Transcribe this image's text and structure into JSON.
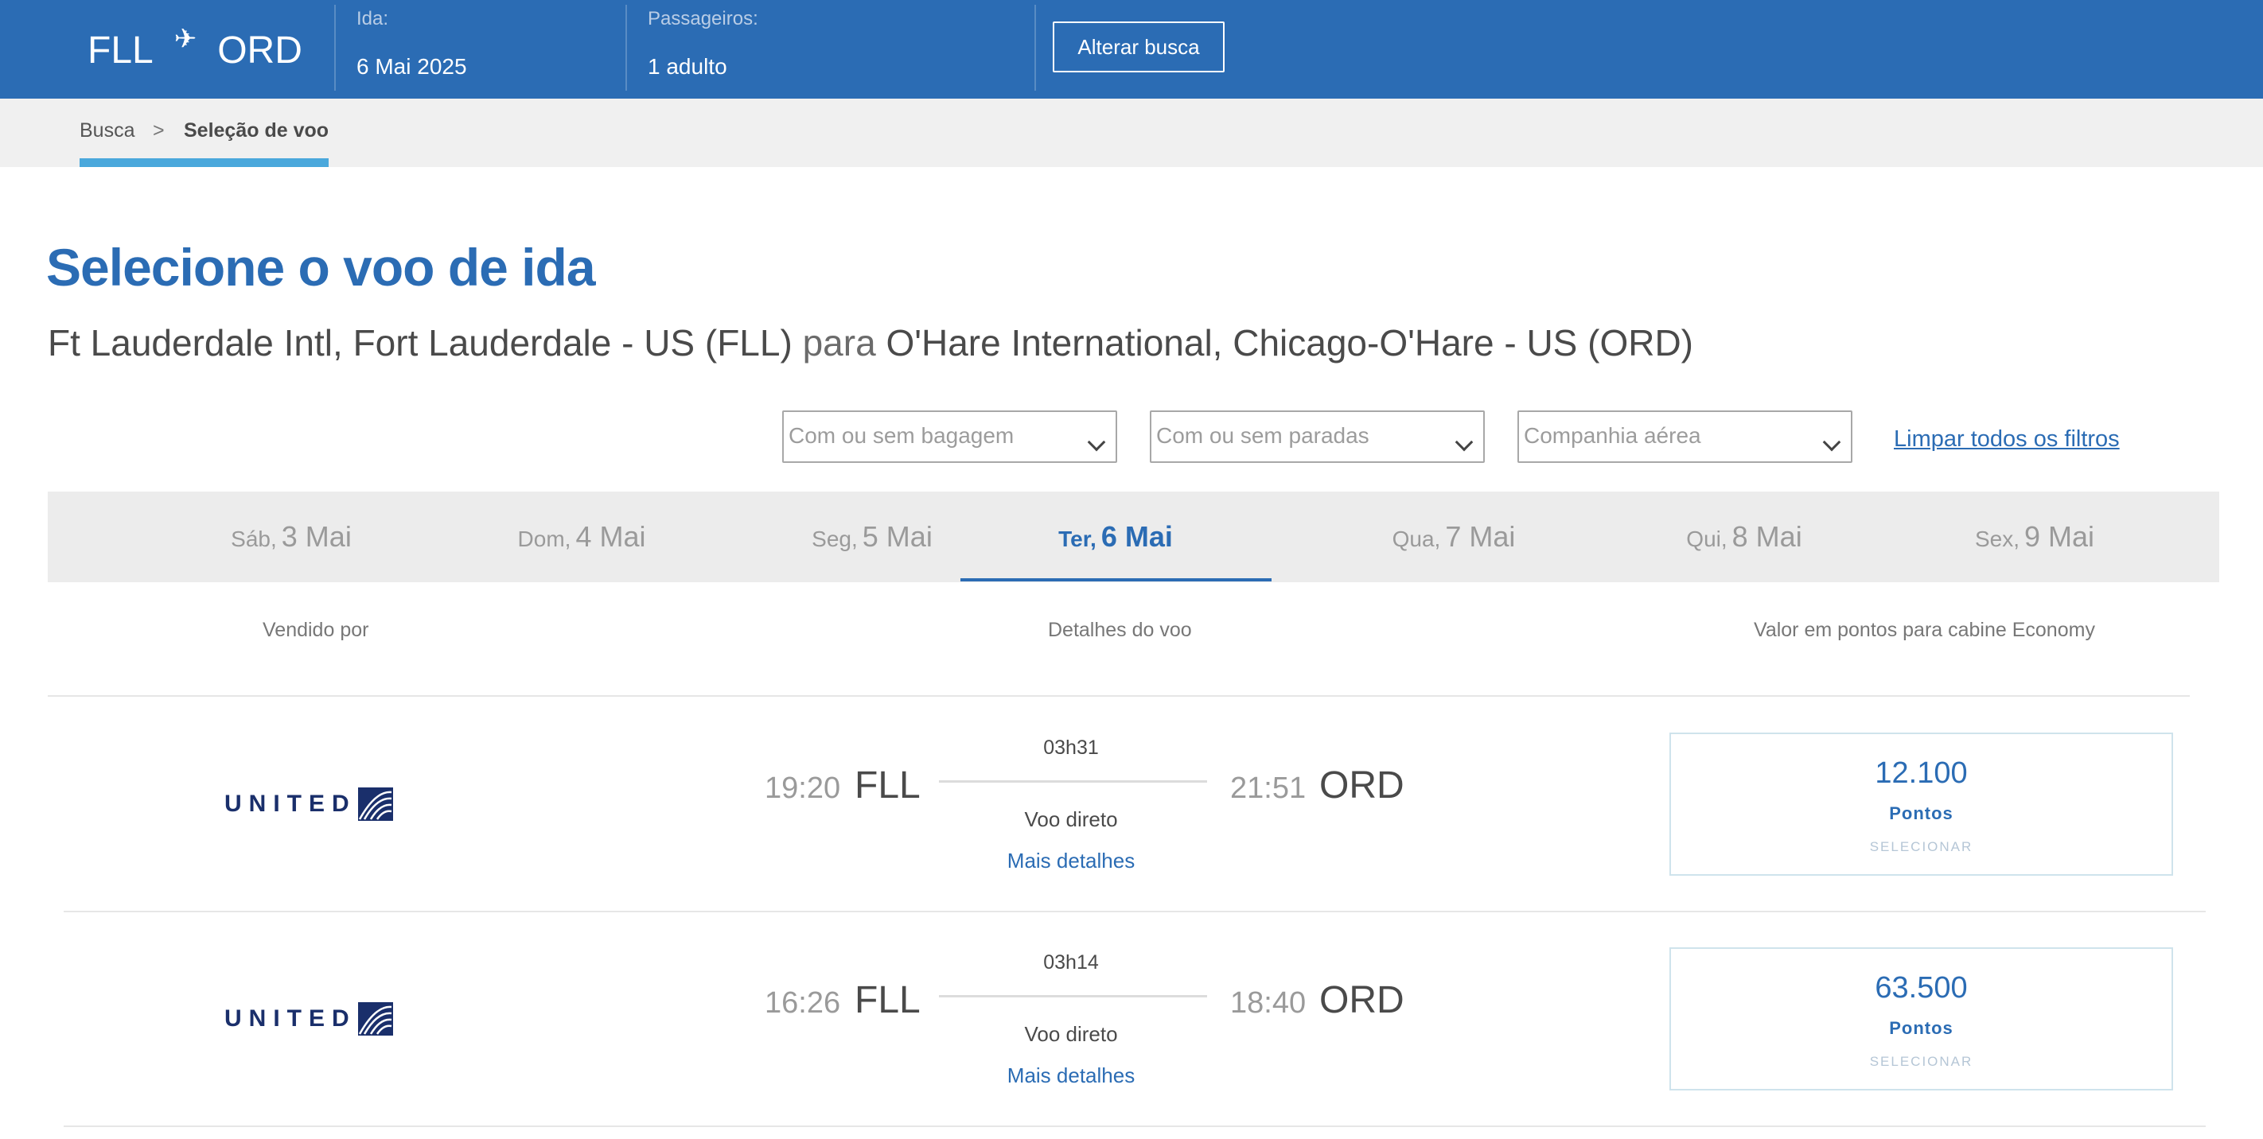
{
  "header": {
    "origin": "FLL",
    "destination": "ORD",
    "departure_label": "Ida:",
    "departure_value": "6 Mai 2025",
    "passengers_label": "Passageiros:",
    "passengers_value": "1 adulto",
    "change_search": "Alterar busca"
  },
  "breadcrumb": {
    "home": "Busca",
    "separator": ">",
    "current": "Seleção de voo"
  },
  "page": {
    "title": "Selecione o voo de ida",
    "origin_full": "Ft Lauderdale Intl, Fort Lauderdale - US (FLL)",
    "connector": "para",
    "destination_full": "O'Hare International, Chicago-O'Hare - US (ORD)"
  },
  "filters": {
    "baggage": "Com ou sem bagagem",
    "stops": "Com ou sem paradas",
    "airline": "Companhia aérea",
    "clear": "Limpar todos os filtros"
  },
  "dates": [
    {
      "dow": "Sáb,",
      "dm": "3 Mai",
      "active": false
    },
    {
      "dow": "Dom,",
      "dm": "4 Mai",
      "active": false
    },
    {
      "dow": "Seg,",
      "dm": "5 Mai",
      "active": false
    },
    {
      "dow": "Ter,",
      "dm": "6 Mai",
      "active": true
    },
    {
      "dow": "Qua,",
      "dm": "7 Mai",
      "active": false
    },
    {
      "dow": "Qui,",
      "dm": "8 Mai",
      "active": false
    },
    {
      "dow": "Sex,",
      "dm": "9 Mai",
      "active": false
    }
  ],
  "columns": {
    "sold_by": "Vendido por",
    "details": "Detalhes do voo",
    "points": "Valor em pontos para cabine Economy"
  },
  "flights": [
    {
      "airline": "UNITED",
      "dep_time": "19:20",
      "dep_code": "FLL",
      "duration": "03h31",
      "arr_time": "21:51",
      "arr_code": "ORD",
      "stops": "Voo direto",
      "more": "Mais detalhes",
      "points": "12.100",
      "points_label": "Pontos",
      "select": "SELECIONAR"
    },
    {
      "airline": "UNITED",
      "dep_time": "16:26",
      "dep_code": "FLL",
      "duration": "03h14",
      "arr_time": "18:40",
      "arr_code": "ORD",
      "stops": "Voo direto",
      "more": "Mais detalhes",
      "points": "63.500",
      "points_label": "Pontos",
      "select": "SELECIONAR"
    }
  ],
  "icons": {
    "plane": "airplane-icon",
    "chevron": "chevron-down-icon",
    "airline_logo": "united-globe-logo"
  },
  "colors": {
    "brand_blue": "#2b6cb4",
    "accent_light_blue": "#4aa8dc",
    "breadcrumb_bg": "#f0f0f0",
    "datebar_bg": "#ececec"
  }
}
